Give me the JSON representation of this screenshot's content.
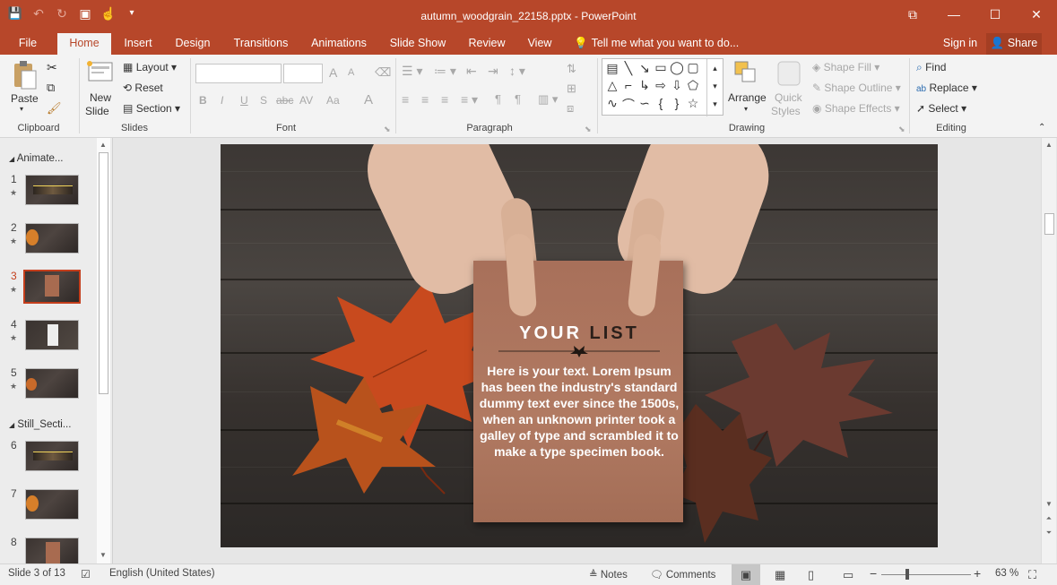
{
  "window": {
    "title": "autumn_woodgrain_22158.pptx - PowerPoint",
    "restore_glyph": "⧉",
    "minimize_glyph": "—",
    "maximize_glyph": "☐",
    "close_glyph": "✕"
  },
  "quick_access": {
    "save_icon": "💾",
    "undo_icon": "↶",
    "redo_icon": "↻",
    "present_icon": "▣",
    "touch_icon": "☝",
    "customize_icon": "▾"
  },
  "tabs": [
    "File",
    "Home",
    "Insert",
    "Design",
    "Transitions",
    "Animations",
    "Slide Show",
    "Review",
    "View"
  ],
  "tell_me": "Tell me what you want to do...",
  "sign_in": "Sign in",
  "share": "Share",
  "ribbon": {
    "clipboard": {
      "paste": "Paste",
      "label": "Clipboard"
    },
    "slides": {
      "new_slide": "New",
      "new_slide2": "Slide",
      "layout": "Layout",
      "reset": "Reset",
      "section": "Section",
      "label": "Slides"
    },
    "font": {
      "label": "Font",
      "bold": "B",
      "italic": "I",
      "underline": "U",
      "shadow": "S",
      "strike": "abc",
      "spacing": "AV",
      "case": "Aa",
      "color": "A",
      "grow": "A",
      "shrink": "A"
    },
    "paragraph": {
      "label": "Paragraph"
    },
    "drawing": {
      "arrange": "Arrange",
      "quick1": "Quick",
      "quick2": "Styles",
      "shape_fill": "Shape Fill",
      "shape_outline": "Shape Outline",
      "shape_effects": "Shape Effects",
      "label": "Drawing"
    },
    "editing": {
      "find": "Find",
      "replace": "Replace",
      "select": "Select",
      "label": "Editing"
    }
  },
  "slide_panel": {
    "sections": [
      "Animate...",
      "Still_Secti..."
    ],
    "slide_numbers": [
      "1",
      "2",
      "3",
      "4",
      "5",
      "6",
      "7",
      "8"
    ],
    "active_slide": "3"
  },
  "slide": {
    "title_part1": "YOUR",
    "title_part2": "LIST",
    "body": "Here is your text. Lorem Ipsum has been the industry's standard dummy text ever since the 1500s, when an unknown printer took a galley of type and scrambled it to make a type specimen book."
  },
  "status": {
    "slide_info": "Slide 3 of 13",
    "language": "English (United States)",
    "notes": "Notes",
    "comments": "Comments",
    "zoom": "63 %",
    "zoom_minus": "−",
    "zoom_plus": "+"
  }
}
